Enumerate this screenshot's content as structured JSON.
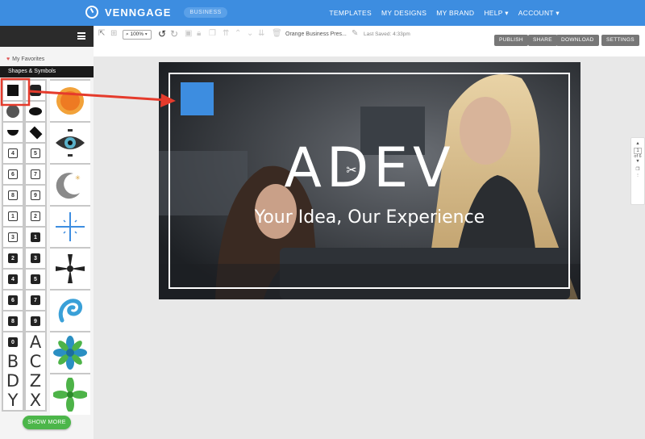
{
  "topnav": {
    "brand": "VENNGAGE",
    "badge": "BUSINESS",
    "links": [
      "TEMPLATES",
      "MY DESIGNS",
      "MY BRAND",
      "HELP ▾",
      "ACCOUNT ▾"
    ]
  },
  "sidebar": {
    "favorites": "My Favorites",
    "category": "Shapes & Symbols",
    "show_more": "SHOW MORE",
    "number_cells": [
      "4",
      "5",
      "6",
      "7",
      "8",
      "9",
      "1",
      "2",
      "3",
      "1",
      "2",
      "3",
      "4",
      "5",
      "6",
      "7",
      "8",
      "9",
      "0"
    ],
    "letter_cells": [
      "A",
      "B",
      "C",
      "D",
      "Z",
      "Y",
      "X"
    ],
    "icons": [
      "sun-icon",
      "eye-icon",
      "moon-icon",
      "sparkle-icon",
      "propeller-icon",
      "spiral-icon",
      "flower-icon",
      "leaf-flower-icon"
    ]
  },
  "toolbar": {
    "zoom": "100%",
    "document_name": "Orange Business Pres...",
    "last_saved": "Last Saved: 4:33pm",
    "buttons": [
      "PUBLISH",
      "SHARE",
      "DOWNLOAD",
      "SETTINGS"
    ]
  },
  "canvas": {
    "title": "ADEV",
    "subtitle": "Your Idea, Our Experience",
    "accent": "#3d8de0"
  },
  "pagenav": {
    "current": "1",
    "of": "of 6"
  }
}
